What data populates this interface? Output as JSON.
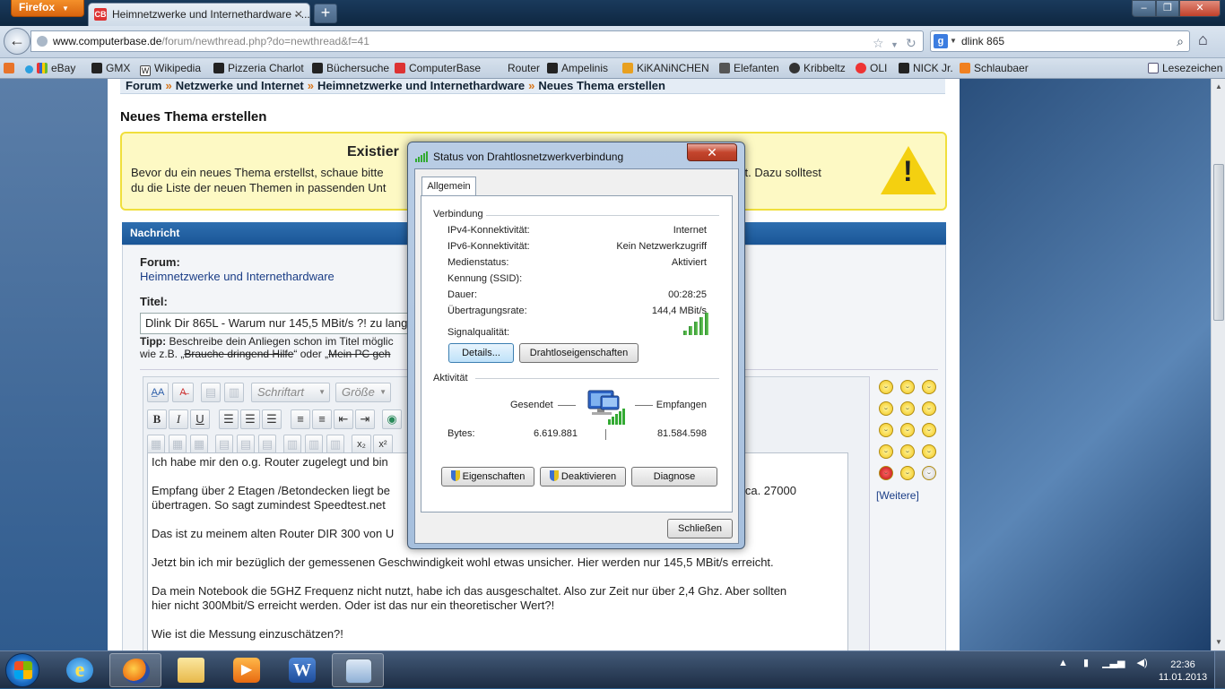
{
  "browser": {
    "app_button": "Firefox",
    "tab_title": "Heimnetzwerke und Internethardware - ...",
    "tab_favicon": "CB",
    "new_tab": "+",
    "window_controls": {
      "minimize": "–",
      "maximize": "❐",
      "close": "✕"
    },
    "url_host": "www.computerbase.de",
    "url_path": "/forum/newthread.php?do=newthread&f=41",
    "search_value": "dlink 865",
    "search_engine": "g",
    "bookmarks": [
      "eBay",
      "GMX",
      "Wikipedia",
      "Pizzeria Charlot",
      "Büchersuche",
      "ComputerBase",
      "Router",
      "Ampelinis",
      "KiKANiNCHEN",
      "Elefanten",
      "Kribbeltz",
      "OLI",
      "NICK Jr.",
      "Schlaubaer"
    ],
    "bookmarks_menu": "Lesezeichen"
  },
  "page": {
    "breadcrumb": [
      "Forum",
      "Netzwerke und Internet",
      "Heimnetzwerke und Internethardware",
      "Neues Thema erstellen"
    ],
    "breadcrumb_sep": "»",
    "title": "Neues Thema erstellen",
    "notice": {
      "heading": "Existier",
      "line1": "Bevor du ein neues Thema erstellst, schaue bitte",
      "line1_end": "stiert. Dazu solltest",
      "line2": "du die Liste der neuen Themen in passenden Unt",
      "warn": "!"
    },
    "message_header": "Nachricht",
    "forum_label": "Forum:",
    "forum_value": "Heimnetzwerke und Internethardware",
    "title_label": "Titel:",
    "title_value": "Dlink Dir 865L - Warum nur 145,5 MBit/s ?! zu lang",
    "tipp_label": "Tipp:",
    "tipp_text": " Beschreibe dein Anliegen schon im Titel möglic",
    "tipp_line2_a": "wie z.B. „",
    "tipp_strike1": "Brauche dringend Hilfe",
    "tipp_line2_b": "“ oder „",
    "tipp_strike2": "Mein PC geh",
    "toolbar": {
      "font": "Schriftart",
      "size": "Größe",
      "bold": "B",
      "italic": "I",
      "underline": "U",
      "sub": "x₂",
      "sup": "x²"
    },
    "body": [
      "Ich habe mir den o.g. Router zugelegt und bin",
      "Empfang über 2 Etagen /Betondecken liegt be",
      "übertragen. So sagt zumindest Speedtest.net",
      "Das ist zu meinem alten Router DIR 300 von U",
      "Jetzt bin ich mir bezüglich der gemessenen Geschwindigkeit wohl etwas unsicher. Hier werden nur 145,5 MBit/s erreicht.",
      "Da mein Notebook die 5GHZ Frequenz nicht nutzt, habe ich das ausgeschaltet. Also zur Zeit nur über 2,4 Ghz. Aber sollten",
      "hier nicht 300Mbit/S erreicht werden. Oder ist das nur ein theoretischer Wert?!",
      "Wie ist die Messung einzuschätzen?!"
    ],
    "body_line2_end": "g ca. 27000",
    "more_smilies": "[Weitere]"
  },
  "dialog": {
    "title": "Status von Drahtlosnetzwerkverbindung",
    "close": "✕",
    "tab": "Allgemein",
    "group_connection": "Verbindung",
    "rows": [
      {
        "label": "IPv4-Konnektivität:",
        "value": "Internet"
      },
      {
        "label": "IPv6-Konnektivität:",
        "value": "Kein Netzwerkzugriff"
      },
      {
        "label": "Medienstatus:",
        "value": "Aktiviert"
      },
      {
        "label": "Kennung (SSID):",
        "value": ""
      },
      {
        "label": "Dauer:",
        "value": "00:28:25"
      },
      {
        "label": "Übertragungsrate:",
        "value": "144,4 MBit/s"
      }
    ],
    "signal_label": "Signalqualität:",
    "signal_bars": 5,
    "btn_details": "Details...",
    "btn_wireless": "Drahtloseigenschaften",
    "group_activity": "Aktivität",
    "sent": "Gesendet",
    "received": "Empfangen",
    "bytes_label": "Bytes:",
    "bytes_sent": "6.619.881",
    "bytes_received": "81.584.598",
    "btn_properties": "Eigenschaften",
    "btn_disable": "Deaktivieren",
    "btn_diagnose": "Diagnose",
    "btn_close": "Schließen"
  },
  "taskbar": {
    "time": "22:36",
    "date": "11.01.2013",
    "tray_arrow": "▲"
  }
}
